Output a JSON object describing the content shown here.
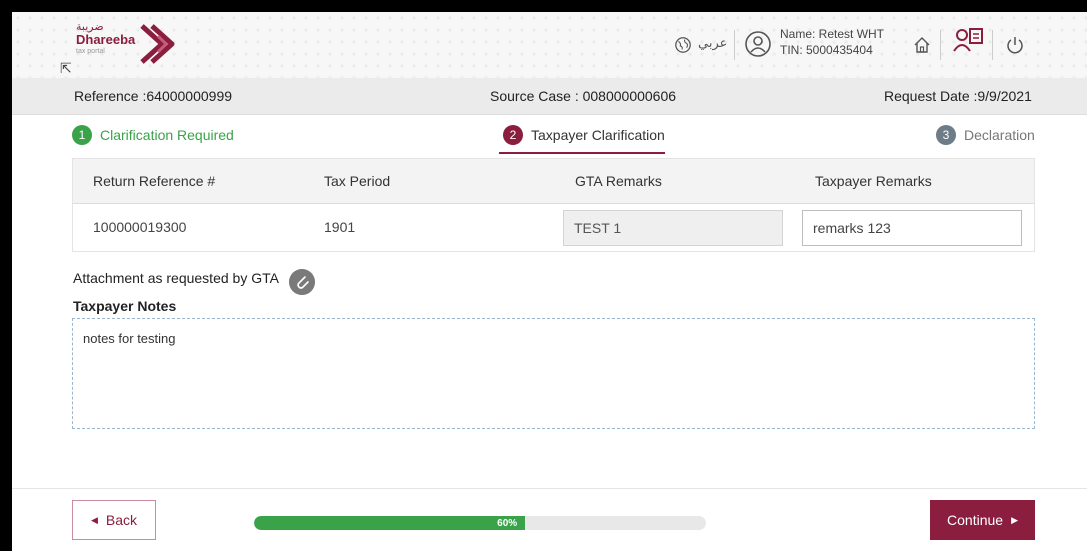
{
  "header": {
    "logo_arabic": "ضريبة",
    "logo_name": "Dhareeba",
    "logo_sub": "tax portal",
    "language_link": "عربي",
    "user_name": "Name: Retest WHT",
    "user_tin": "TIN: 5000435404",
    "icons": [
      "globe-icon",
      "user-icon",
      "home-icon",
      "switch-user-icon",
      "power-icon"
    ]
  },
  "info": {
    "reference": "Reference :64000000999",
    "source_case": "Source Case : 008000000606",
    "request_date": "Request Date :9/9/2021"
  },
  "steps": [
    {
      "num": "1",
      "label": "Clarification Required",
      "state": "done"
    },
    {
      "num": "2",
      "label": "Taxpayer Clarification",
      "state": "active"
    },
    {
      "num": "3",
      "label": "Declaration",
      "state": "pending"
    }
  ],
  "table": {
    "headers": [
      "Return Reference #",
      "Tax Period",
      "GTA Remarks",
      "Taxpayer Remarks"
    ],
    "rows": [
      {
        "return_reference": "100000019300",
        "tax_period": "1901",
        "gta_remarks": "TEST 1",
        "taxpayer_remarks": "remarks 123"
      }
    ]
  },
  "attachment_label": "Attachment as requested by GTA",
  "notes": {
    "label": "Taxpayer Notes",
    "value": "notes for testing"
  },
  "footer": {
    "back_label": "Back",
    "progress": 60,
    "progress_label": "60%",
    "continue_label": "Continue"
  },
  "colors": {
    "brand": "#8b1e3f",
    "success": "#3aa34a",
    "pending": "#6e7c87"
  }
}
